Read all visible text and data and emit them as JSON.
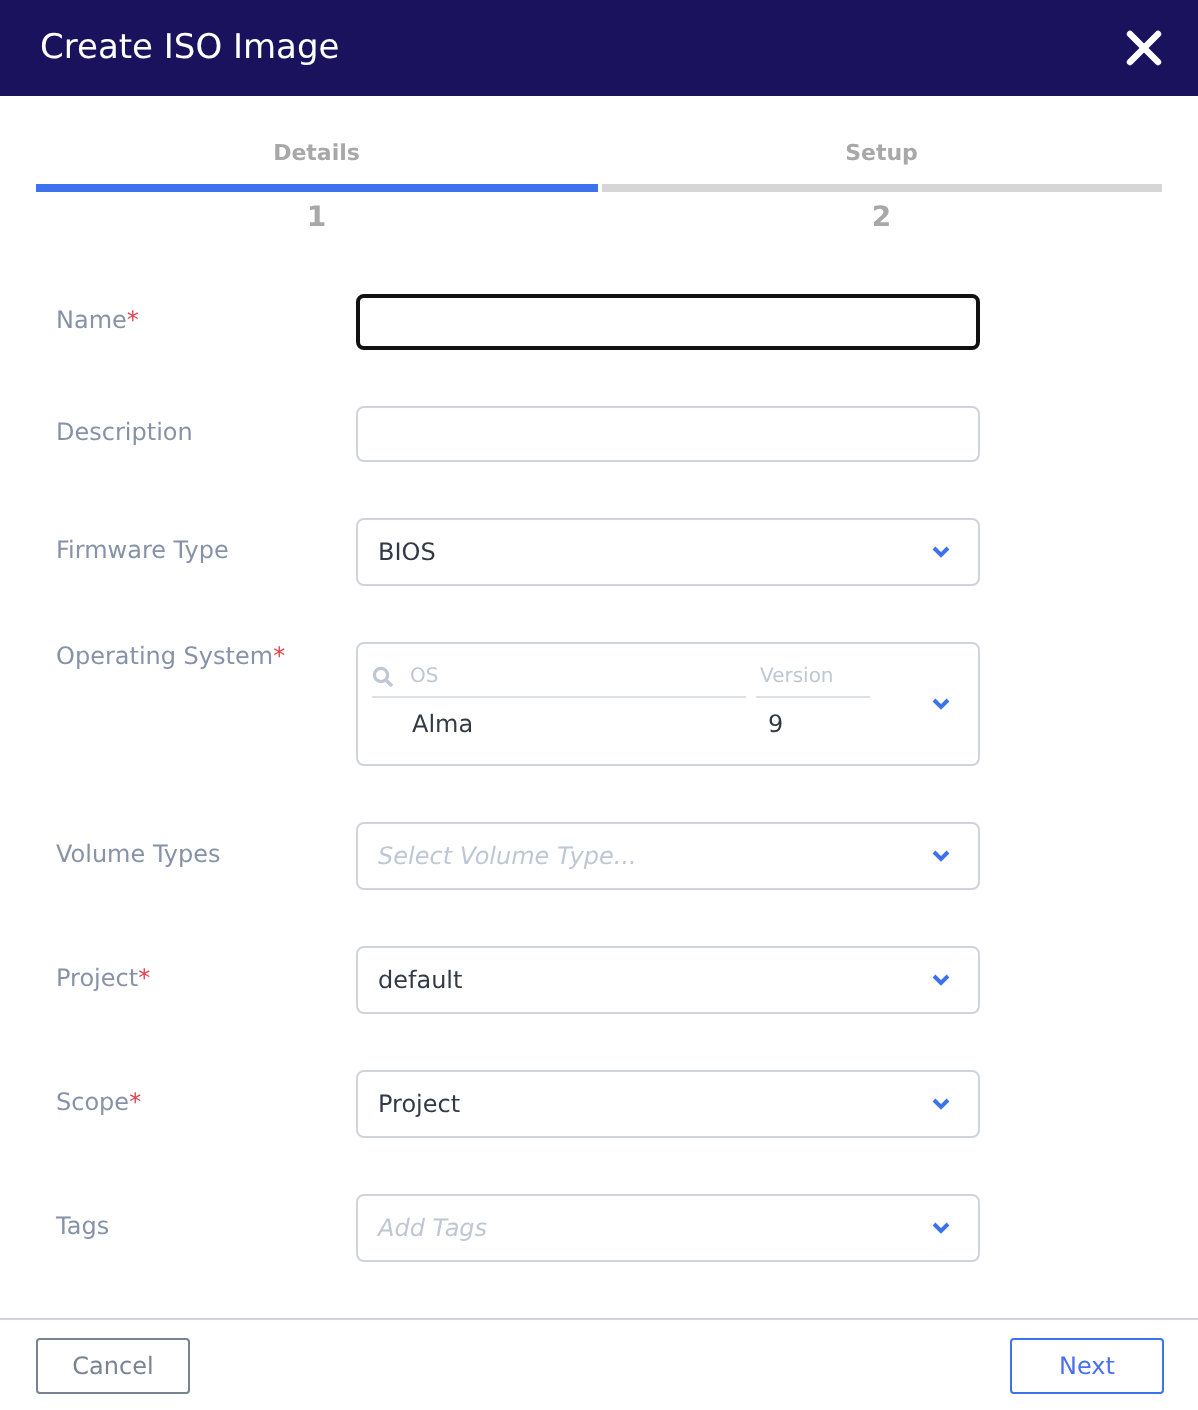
{
  "window": {
    "title": "Create ISO Image"
  },
  "steps": [
    {
      "label": "Details",
      "number": "1",
      "selected": true
    },
    {
      "label": "Setup",
      "number": "2",
      "selected": false
    }
  ],
  "fields": [
    {
      "kind": "text",
      "label": "Name",
      "required_mark": "*",
      "focused": true
    },
    {
      "kind": "text",
      "label": "Description",
      "focused": false
    },
    {
      "kind": "select",
      "label": "Firmware Type",
      "value": "BIOS"
    },
    {
      "kind": "os",
      "label": "Operating System",
      "required_mark": "*",
      "os_placeholder": "OS",
      "version_placeholder": "Version",
      "os_value": "Alma",
      "version_value": "9"
    },
    {
      "kind": "select",
      "label": "Volume Types",
      "placeholder": "Select Volume Type..."
    },
    {
      "kind": "select",
      "label": "Project",
      "required_mark": "*",
      "value": "default"
    },
    {
      "kind": "select",
      "label": "Scope",
      "required_mark": "*",
      "value": "Project"
    },
    {
      "kind": "select",
      "label": "Tags",
      "placeholder": "Add Tags"
    }
  ],
  "buttons": {
    "cancel": "Cancel",
    "next": "Next"
  }
}
